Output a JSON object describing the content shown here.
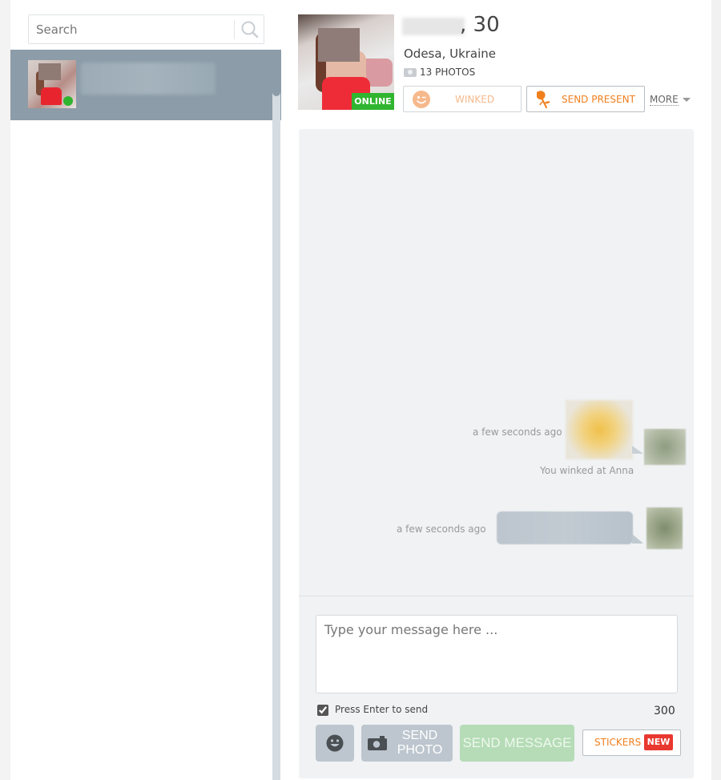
{
  "sidebar": {
    "search": {
      "placeholder": "Search",
      "value": ""
    },
    "contacts": [
      {
        "status": "online",
        "selected": true
      }
    ]
  },
  "profile": {
    "age": ", 30",
    "location": "Odesa, Ukraine",
    "photos_label": "13 PHOTOS",
    "online_label": "ONLINE",
    "actions": {
      "winked_label": "WINKED",
      "send_present_label": "SEND PRESENT",
      "more_label": "MORE"
    }
  },
  "chat": {
    "messages": [
      {
        "time": "a few seconds ago",
        "type": "wink",
        "caption": "You winked at Anna"
      },
      {
        "time": "a few seconds ago",
        "type": "text"
      }
    ]
  },
  "composer": {
    "placeholder": "Type your message here ...",
    "value": "",
    "press_enter_label": "Press Enter to send",
    "press_enter_checked": true,
    "char_count": "300",
    "send_photo_label": "SEND PHOTO",
    "send_message_label": "SEND MESSAGE",
    "stickers_label": "STICKERS",
    "new_badge": "NEW"
  },
  "colors": {
    "online_green": "#2fb52f",
    "accent_orange": "#f07f1e",
    "selected_item": "#8c9ca8",
    "send_button_disabled": "#b5dcb6",
    "new_badge_red": "#e8382f"
  }
}
